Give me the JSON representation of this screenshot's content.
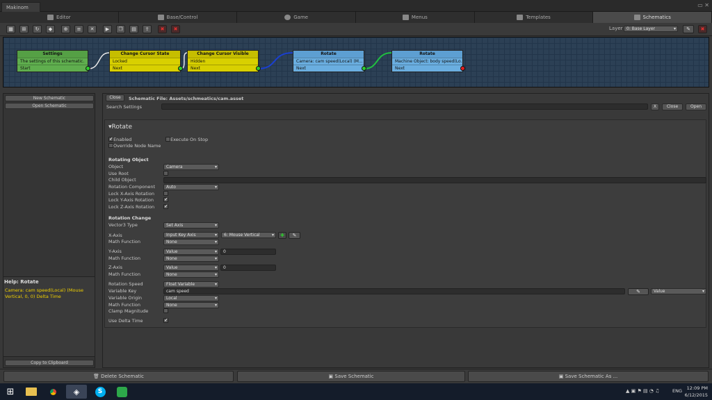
{
  "window": {
    "title": "Makinom"
  },
  "tabs": [
    {
      "label": "Editor",
      "icon": "makinom-m-icon"
    },
    {
      "label": "Base/Control",
      "icon": "gamepad-icon"
    },
    {
      "label": "Game",
      "icon": "globe-icon"
    },
    {
      "label": "Menus",
      "icon": "list-icon"
    },
    {
      "label": "Templates",
      "icon": "page-icon"
    },
    {
      "label": "Schematics",
      "icon": "schematic-icon"
    }
  ],
  "toolbar": {
    "layer_label": "Layer",
    "layer_value": "0: Base Layer"
  },
  "nodes": [
    {
      "title": "Settings",
      "row1": "The settings of this schematic.",
      "row2": "Start",
      "color": "#5fae4e",
      "headcolor": "#55a045"
    },
    {
      "title": "Change Cursor State",
      "row1": "Locked",
      "row2": "Next",
      "color": "#d8d000",
      "headcolor": "#c6be00"
    },
    {
      "title": "Change Cursor Visible",
      "row1": "Hidden",
      "row2": "Next",
      "color": "#d8d000",
      "headcolor": "#c6be00"
    },
    {
      "title": "Rotate",
      "row1": "Camera: cam speed(Local) (M...",
      "row2": "Next",
      "color": "#6aaee0",
      "headcolor": "#5d9fd2"
    },
    {
      "title": "Rotate",
      "row1": "Machine Object: body speed(Lo...",
      "row2": "Next",
      "color": "#6aaee0",
      "headcolor": "#5d9fd2"
    }
  ],
  "left": {
    "new_schematic": "New Schematic",
    "open_schematic": "Open Schematic",
    "help_title": "Help: Rotate",
    "help_text": "Camera: cam speed(Local) (Mouse Vertical, 0, 0) Delta Time",
    "copy_clipboard": "Copy to Clipboard"
  },
  "file": {
    "close_label": "Close",
    "file_label": "Schematic File: Assets/schmeatics/cam.asset",
    "search_label": "Search Settings",
    "search_clear": "X",
    "search_close": "Close",
    "search_open": "Open"
  },
  "section": {
    "title": "Rotate"
  },
  "general": {
    "enabled": "Enabled",
    "execute_on_stop": "Execute On Stop",
    "override_node_name": "Override Node Name"
  },
  "rotating": {
    "header": "Rotating Object",
    "object_label": "Object",
    "object_value": "Camera",
    "use_root": "Use Root",
    "child_object": "Child Object",
    "rotation_component": "Rotation Component",
    "rotation_component_value": "Auto",
    "lock_x": "Lock X-Axis Rotation",
    "lock_y": "Lock Y-Axis Rotation",
    "lock_z": "Lock Z-Axis Rotation"
  },
  "change": {
    "header": "Rotation Change",
    "vector3_type": "Vector3 Type",
    "vector3_value": "Set Axis",
    "x_axis": "X-Axis",
    "x_type": "Input Key Axis",
    "x_key": "6: Mouse Vertical",
    "x_math": "Math Function",
    "x_math_value": "None",
    "y_axis": "Y-Axis",
    "y_type": "Value",
    "y_value": "0",
    "y_math": "Math Function",
    "y_math_value": "None",
    "z_axis": "Z-Axis",
    "z_type": "Value",
    "z_value": "0",
    "z_math": "Math Function",
    "z_math_value": "None",
    "rotation_speed": "Rotation Speed",
    "rotation_speed_value": "Float Variable",
    "variable_key": "Variable Key",
    "variable_key_value": "cam speed",
    "variable_key_type": "Value",
    "variable_origin": "Variable Origin",
    "variable_origin_value": "Local",
    "math_function": "Math Function",
    "math_function_value": "None",
    "clamp_magnitude": "Clamp Magnitude",
    "use_delta_time": "Use Delta Time"
  },
  "bottom": {
    "delete": "Delete Schematic",
    "save": "Save Schematic",
    "save_as": "Save Schematic As ..."
  },
  "taskbar": {
    "language": "ENG",
    "time": "12:09 PM",
    "date": "6/12/2015"
  }
}
